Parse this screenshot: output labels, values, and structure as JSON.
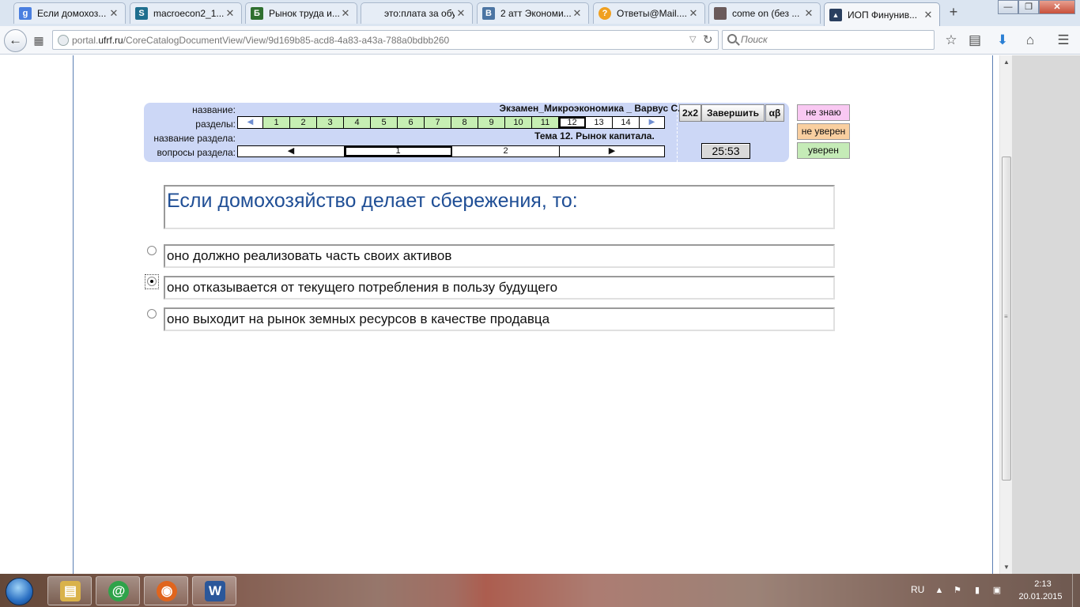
{
  "browser": {
    "tabs": [
      {
        "label": "Если домохоз...",
        "favicon": "google-icon",
        "color": "#4a7fe0",
        "glyph": "g"
      },
      {
        "label": "macroecon2_1...",
        "favicon": "slideshare-icon",
        "color": "#1f6f8f",
        "glyph": "S"
      },
      {
        "label": "Рынок труда и...",
        "favicon": "b-icon",
        "color": "#2f6f2f",
        "glyph": "Б"
      },
      {
        "label": "это:плата за обуч...",
        "favicon": "blank-icon",
        "color": "#eeeeee",
        "glyph": ""
      },
      {
        "label": "2 атт Экономи...",
        "favicon": "vk-icon",
        "color": "#4c75a3",
        "glyph": "B"
      },
      {
        "label": "Ответы@Mail....",
        "favicon": "answers-icon",
        "color": "#f0a020",
        "glyph": "?"
      },
      {
        "label": "come on (без ...",
        "favicon": "photo-icon",
        "color": "#6a5a5a",
        "glyph": ""
      },
      {
        "label": "ИОП Финунив...",
        "favicon": "mortarboard-icon",
        "color": "#2a3f5f",
        "glyph": "🎓"
      }
    ],
    "new_tab": "+",
    "window_controls": {
      "minimize": "—",
      "maximize": "❐",
      "close": "✕"
    },
    "back": "←",
    "url_prefix": "portal.",
    "url_domain": "ufrf.ru",
    "url_path": "/CoreCatalogDocumentView/View/9d169b85-acd8-4a83-a43a-788a0bdbb260",
    "search_placeholder": "Поиск",
    "toolbar_icons": [
      "star-icon",
      "reading-list-icon",
      "download-icon",
      "home-icon",
      "menu-icon"
    ]
  },
  "test": {
    "labels": {
      "name": "название:",
      "sections": "разделы:",
      "section_name": "название раздела:",
      "section_questions": "вопросы раздела:"
    },
    "title": "Экзамен_Микроэкономика _ Варвус С.А.",
    "sections": [
      {
        "label": "1",
        "state": "done"
      },
      {
        "label": "2",
        "state": "done"
      },
      {
        "label": "3",
        "state": "done"
      },
      {
        "label": "4",
        "state": "done"
      },
      {
        "label": "5",
        "state": "done"
      },
      {
        "label": "6",
        "state": "done"
      },
      {
        "label": "7",
        "state": "done"
      },
      {
        "label": "8",
        "state": "done"
      },
      {
        "label": "9",
        "state": "done"
      },
      {
        "label": "10",
        "state": "done"
      },
      {
        "label": "11",
        "state": "done"
      },
      {
        "label": "12",
        "state": "current"
      },
      {
        "label": "13",
        "state": "todo"
      },
      {
        "label": "14",
        "state": "todo"
      }
    ],
    "section_name": "Тема 12. Рынок капитала.",
    "questions": [
      {
        "label": "1",
        "state": "current"
      },
      {
        "label": "2",
        "state": "todo"
      }
    ],
    "buttons": {
      "calc": "2x2",
      "finish": "Завершить",
      "alphabet": "αβ"
    },
    "timer": "25:53",
    "confidence": {
      "dont_know": "не знаю",
      "unsure": "не уверен",
      "sure": "уверен"
    },
    "question": "Если домохозяйство делает сбережения, то:",
    "answers": [
      {
        "text": "оно должно реализовать часть своих активов",
        "selected": false
      },
      {
        "text": "оно отказывается от текущего потребления в пользу будущего",
        "selected": true
      },
      {
        "text": "оно выходит на рынок земных ресурсов в качестве продавца",
        "selected": false
      }
    ]
  },
  "taskbar": {
    "apps": [
      {
        "name": "explorer-icon",
        "glyph": "▤",
        "color": "#d9b24a"
      },
      {
        "name": "mail-agent-icon",
        "glyph": "@",
        "color": "#2fa34a"
      },
      {
        "name": "firefox-icon",
        "glyph": "◉",
        "color": "#e0651e"
      },
      {
        "name": "word-icon",
        "glyph": "W",
        "color": "#2b579a"
      }
    ],
    "language": "RU",
    "time": "2:13",
    "date": "20.01.2015"
  }
}
